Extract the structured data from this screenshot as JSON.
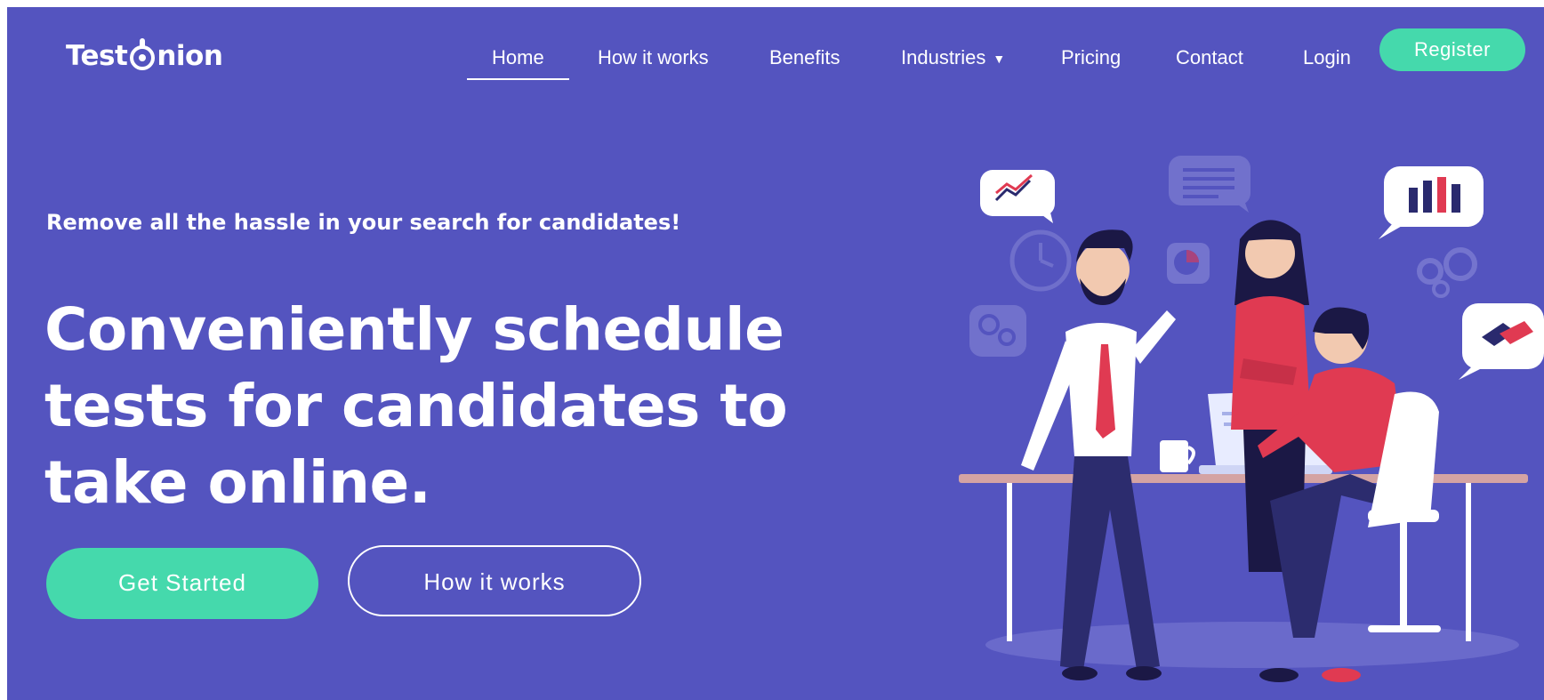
{
  "brand": {
    "logo_text_before": "Test",
    "logo_text_after": "nion"
  },
  "nav": {
    "items": [
      {
        "label": "Home",
        "active": true
      },
      {
        "label": "How it works"
      },
      {
        "label": "Benefits"
      },
      {
        "label": "Industries",
        "has_dropdown": true
      },
      {
        "label": "Pricing"
      },
      {
        "label": "Contact"
      },
      {
        "label": "Login"
      }
    ],
    "register_label": "Register"
  },
  "hero": {
    "tagline": "Remove all the hassle in your search for candidates!",
    "headline": "Conveniently schedule tests for candidates to take online.",
    "primary_button": "Get Started",
    "secondary_button": "How it works"
  },
  "colors": {
    "background": "#5454bf",
    "accent": "#45d9ac",
    "text": "#ffffff",
    "shirt_red": "#e03a52",
    "dark_navy": "#1b1845"
  },
  "icons": [
    "chart-bubble-icon",
    "document-bubble-icon",
    "bar-chart-bubble-icon",
    "clock-icon",
    "pie-chart-icon",
    "gears-icon",
    "handshake-bubble-icon",
    "coffee-cup-icon",
    "laptop-icon",
    "chair-icon"
  ]
}
